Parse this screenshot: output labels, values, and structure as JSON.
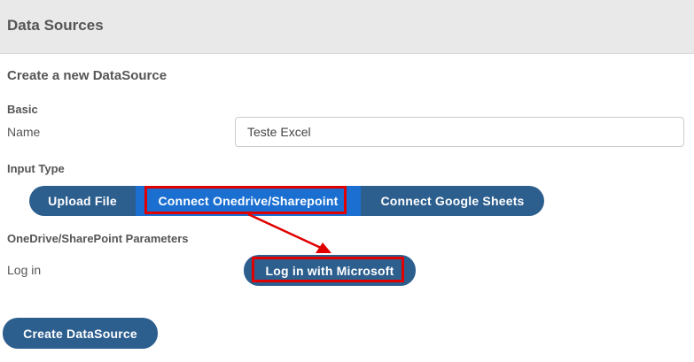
{
  "header": {
    "title": "Data Sources"
  },
  "form": {
    "title": "Create a new DataSource",
    "basic": {
      "group_label": "Basic",
      "name_label": "Name",
      "name_value": "Teste Excel"
    },
    "input_type": {
      "group_label": "Input Type",
      "options": [
        {
          "label": "Upload File",
          "selected": false
        },
        {
          "label": "Connect Onedrive/Sharepoint",
          "selected": true
        },
        {
          "label": "Connect Google Sheets",
          "selected": false
        }
      ]
    },
    "onedrive": {
      "group_label": "OneDrive/SharePoint Parameters",
      "login_label": "Log in",
      "login_button": "Log in with Microsoft"
    },
    "create_button": "Create DataSource"
  },
  "colors": {
    "primary": "#2c5e8e",
    "selected": "#1a6fd1",
    "annotation": "#e00000",
    "header_bg": "#e9e9e9"
  }
}
